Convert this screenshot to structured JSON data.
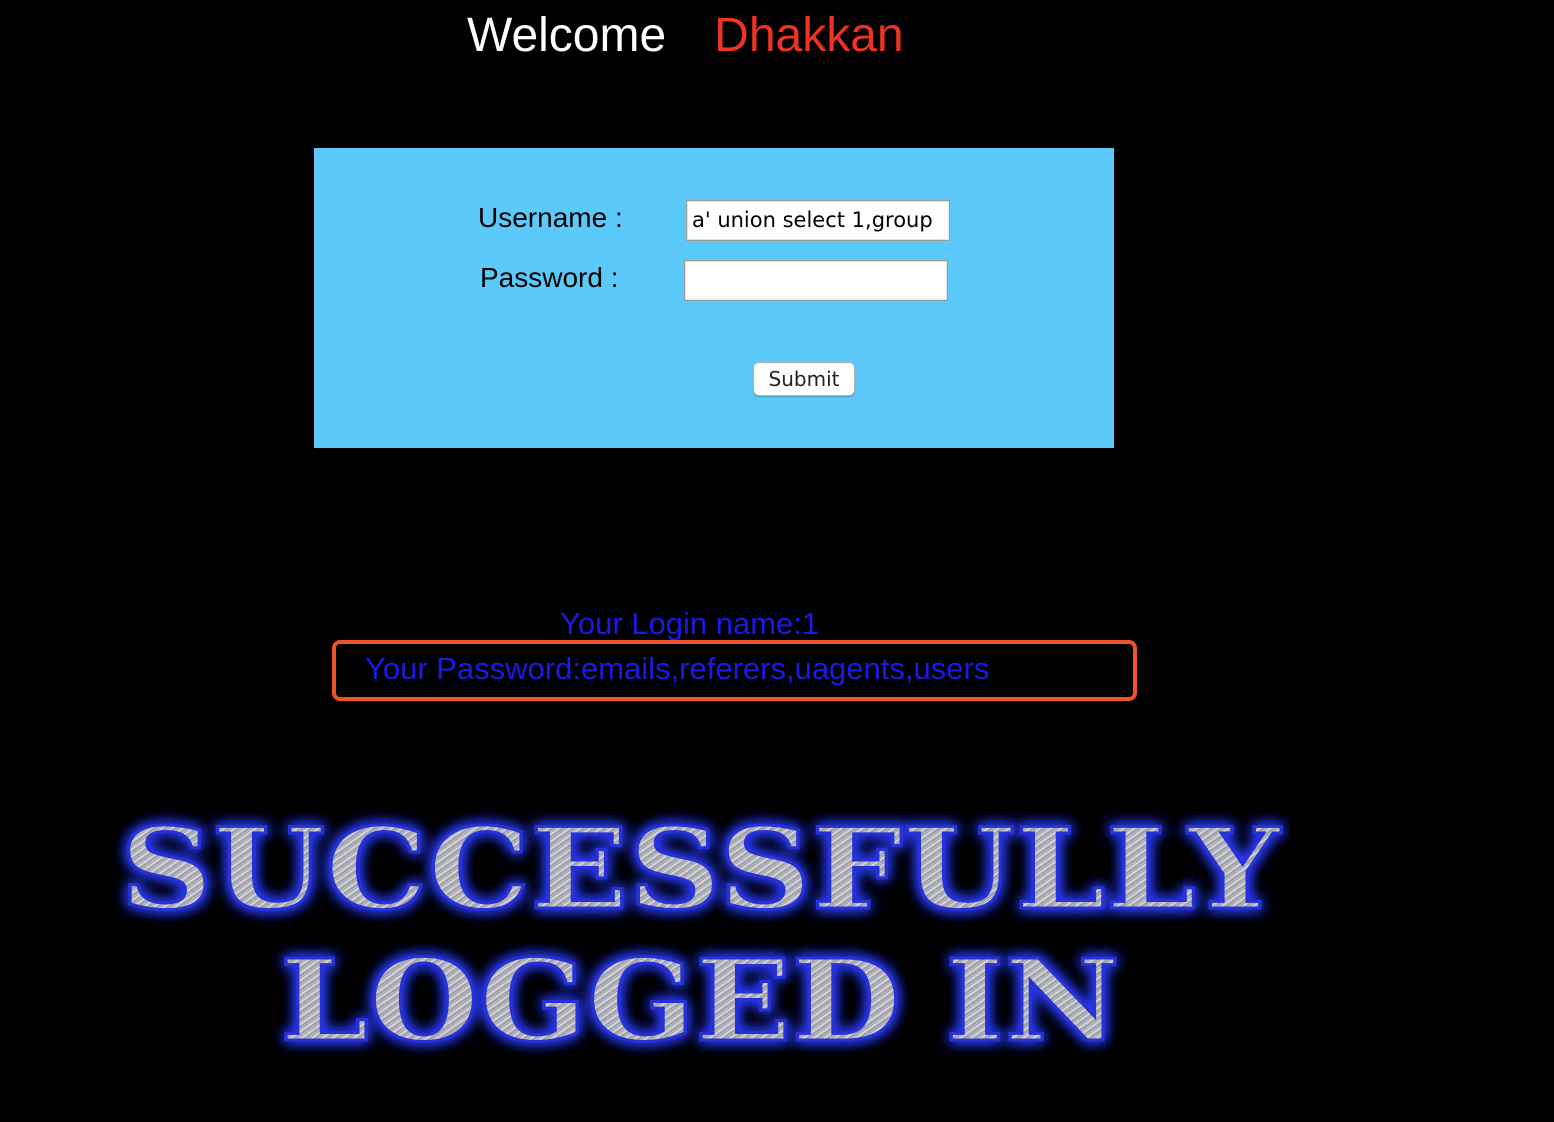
{
  "header": {
    "welcome": "Welcome",
    "name": "Dhakkan"
  },
  "form": {
    "username_label": "Username :",
    "username_value": "a' union select 1,group",
    "password_label": "Password :",
    "password_value": "",
    "submit_label": "Submit"
  },
  "result": {
    "login_name": "Your Login name:1",
    "password": "Your Password:emails,referers,uagents,users"
  },
  "banner": {
    "line1": "SUCCESSFULLY",
    "line2": "LOGGED IN"
  },
  "colors": {
    "background": "#000000",
    "panel": "#5bc9f9",
    "welcome_name": "#ee3322",
    "result_text": "#1a1ae6",
    "highlight_border": "#f0522a",
    "banner_glow": "#2a3cff"
  }
}
